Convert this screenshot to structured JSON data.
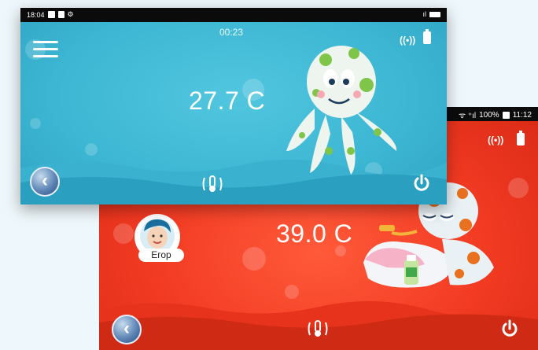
{
  "red_screen": {
    "status": {
      "signal_text": "ᯤ ⁺ıl",
      "battery": "100%",
      "time": "11:12"
    },
    "temperature": "39.0 C",
    "profile_name": "Егор",
    "colors": {
      "bg": "#f23a22",
      "accent": "#ffffff"
    }
  },
  "blue_screen": {
    "status": {
      "time": "18:04"
    },
    "timer": "00:23",
    "temperature": "27.7 C",
    "colors": {
      "bg": "#3cb6d3",
      "accent": "#ffffff"
    }
  },
  "icons": [
    "menu-icon",
    "back-icon",
    "thermometer-icon",
    "power-icon",
    "signal-icon",
    "battery-icon",
    "avatar-icon",
    "octopus-mascot-icon"
  ]
}
